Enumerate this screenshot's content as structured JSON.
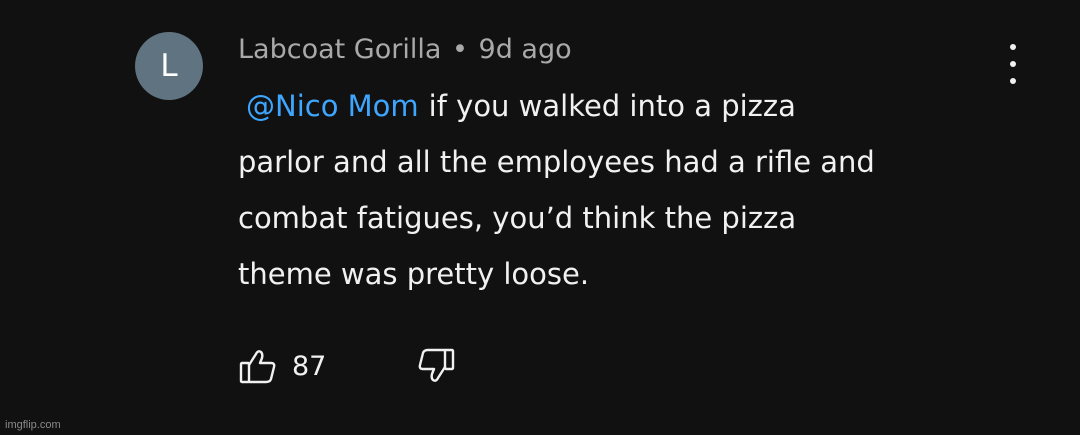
{
  "comment": {
    "avatar_letter": "L",
    "author": "Labcoat Gorilla",
    "separator": "•",
    "time": "9d ago",
    "mention": "@Nico Mom",
    "text_lines": [
      "if you walked into a pizza",
      "parlor and all the employees had a rifle and",
      "combat fatigues, you’d think the pizza",
      "theme was pretty loose."
    ],
    "like_count": "87",
    "icons": {
      "menu": "more-vert-icon",
      "like": "thumbs-up-icon",
      "dislike": "thumbs-down-icon"
    },
    "colors": {
      "background": "#111111",
      "mention": "#3ea6ff",
      "avatar": "#5f7480",
      "meta": "#a9a9a9"
    }
  },
  "watermark": "imgflip.com"
}
